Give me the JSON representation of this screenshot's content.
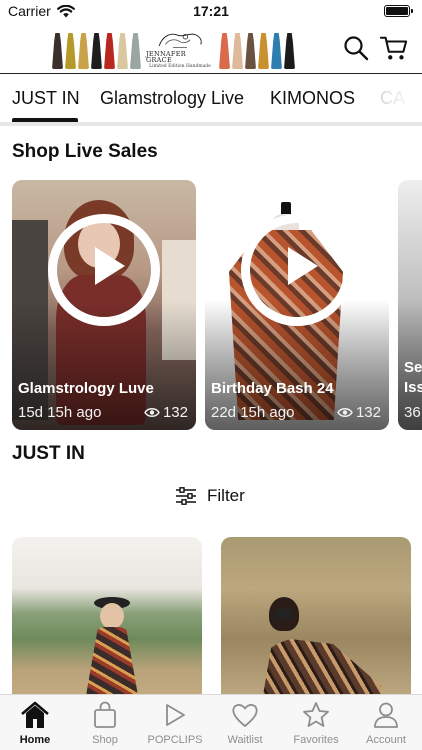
{
  "status_bar": {
    "carrier": "Carrier",
    "time": "17:21"
  },
  "header": {
    "logo_name": "JENNAFER GRACE",
    "logo_sub": "Limited Edition Handmade"
  },
  "tabs": [
    {
      "label": "JUST IN",
      "active": true
    },
    {
      "label": "Glamstrology Live",
      "active": false
    },
    {
      "label": "KIMONOS",
      "active": false
    },
    {
      "label": "CA",
      "active": false
    }
  ],
  "live_section": {
    "title": "Shop Live Sales",
    "cards": [
      {
        "title": "Glamstrology Luve",
        "age": "15d 15h ago",
        "views": "132"
      },
      {
        "title": "Birthday Bash 24",
        "age": "22d 15h ago",
        "views": "132"
      },
      {
        "title": "Se Iss",
        "age": "36",
        "views": ""
      }
    ]
  },
  "just_in": {
    "title": "JUST IN",
    "filter_label": "Filter"
  },
  "bottom_nav": [
    {
      "label": "Home",
      "icon": "home-icon",
      "active": true
    },
    {
      "label": "Shop",
      "icon": "bag-icon",
      "active": false
    },
    {
      "label": "POPCLIPS",
      "icon": "play-icon",
      "active": false
    },
    {
      "label": "Waitlist",
      "icon": "heart-icon",
      "active": false
    },
    {
      "label": "Favorites",
      "icon": "star-icon",
      "active": false
    },
    {
      "label": "Account",
      "icon": "person-icon",
      "active": false
    }
  ],
  "colors": {
    "accent": "#111111",
    "inactive": "#8e8e8e",
    "nav_bg": "#f7f7f7"
  }
}
